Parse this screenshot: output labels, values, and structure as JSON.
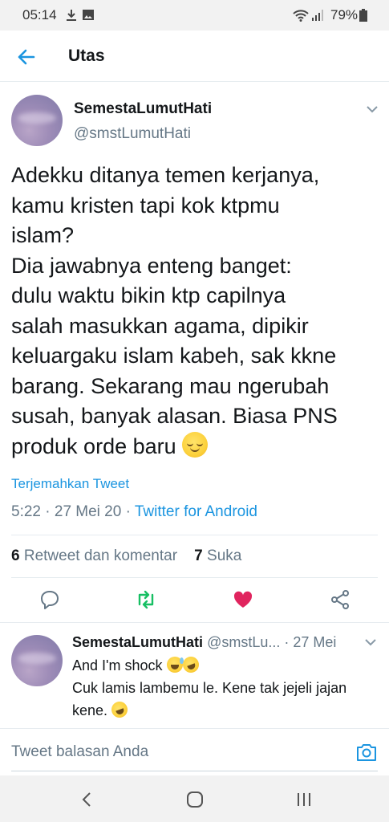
{
  "status_bar": {
    "time": "05:14",
    "battery": "79%"
  },
  "header": {
    "title": "Utas"
  },
  "tweet": {
    "author_name": "SemestaLumutHati",
    "handle": "@smstLumutHati",
    "lines": [
      "Adekku ditanya temen kerjanya,",
      "kamu kristen tapi kok ktpmu",
      "islam?",
      "Dia jawabnya enteng banget:",
      "dulu waktu bikin ktp capilnya",
      "salah masukkan agama, dipikir",
      "keluargaku islam kabeh, sak kkne",
      "barang. Sekarang mau ngerubah",
      "susah, banyak alasan. Biasa PNS",
      "produk orde baru"
    ],
    "translate_label": "Terjemahkan Tweet",
    "time": "5:22",
    "date": "27 Mei 20",
    "source": "Twitter for Android"
  },
  "stats": {
    "retweets_count": "6",
    "retweets_label": "Retweet dan komentar",
    "likes_count": "7",
    "likes_label": "Suka"
  },
  "actions": [
    "reply-icon",
    "retweet-icon",
    "like-icon",
    "share-icon"
  ],
  "reply": {
    "author_name": "SemestaLumutHati",
    "handle": "@smstLu...",
    "date": "27 Mei",
    "line1": "And I'm shock",
    "line2": "Cuk lamis lambemu le. Kene tak jejeli jajan",
    "line3": "kene."
  },
  "reply_box": {
    "placeholder": "Tweet balasan Anda"
  },
  "colors": {
    "accent": "#1b95e0",
    "retweet": "#17bf63",
    "like": "#e0245e",
    "muted": "#657786"
  }
}
